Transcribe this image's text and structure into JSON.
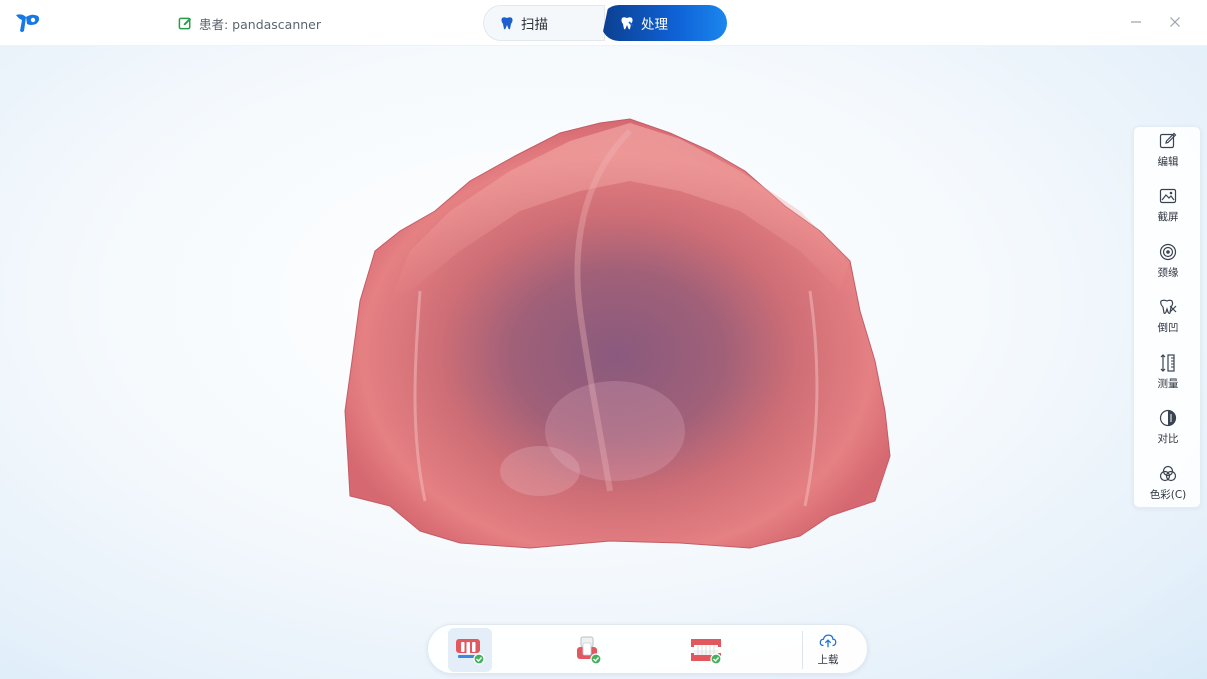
{
  "titlebar": {
    "logo_icon": "app-logo-icon",
    "patient_label": "患者: pandascanner",
    "tabs": [
      {
        "label": "扫描",
        "icon": "tooth-scan-icon",
        "active": false
      },
      {
        "label": "处理",
        "icon": "tooth-process-icon",
        "active": true
      }
    ],
    "window_controls": [
      "minimize-icon",
      "close-icon"
    ]
  },
  "viewport": {
    "content": "3d-scan-model",
    "model_icon": "upper-palate-scan"
  },
  "toolbar": {
    "tools": [
      {
        "label": "编辑",
        "icon": "edit-icon"
      },
      {
        "label": "截屏",
        "icon": "screenshot-icon"
      },
      {
        "label": "颈缘",
        "icon": "margin-line-icon"
      },
      {
        "label": "倒凹",
        "icon": "undercut-icon"
      },
      {
        "label": "测量",
        "icon": "measure-icon"
      },
      {
        "label": "对比",
        "icon": "compare-icon"
      },
      {
        "label": "色彩(C)",
        "icon": "color-icon"
      }
    ]
  },
  "bottombar": {
    "items": [
      {
        "name": "upper-jaw",
        "icon": "upper-jaw-icon",
        "selected": true,
        "status": "check"
      },
      {
        "name": "single-tooth",
        "icon": "single-tooth-icon",
        "selected": false,
        "status": "check"
      },
      {
        "name": "bite",
        "icon": "bite-icon",
        "selected": false,
        "status": "check"
      }
    ],
    "upload_label": "上载",
    "upload_icon": "cloud-upload-icon"
  },
  "colors": {
    "accent": "#0f62d6",
    "accent_dark": "#0b3f8f",
    "logo": "#1677e8",
    "check_green": "#43b05c"
  }
}
